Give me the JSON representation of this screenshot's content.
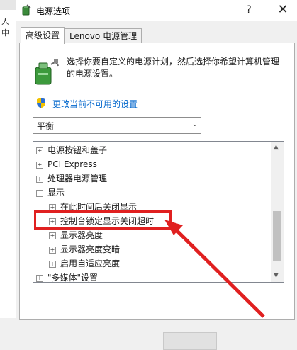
{
  "background_app": {
    "fragment": "人中"
  },
  "window": {
    "title": "电源选项",
    "help_label": "?",
    "close_label": "✕"
  },
  "tabs": [
    {
      "label": "高级设置",
      "active": true
    },
    {
      "label": "Lenovo 电源管理",
      "active": false
    }
  ],
  "description": "选择你要自定义的电源计划，然后选择你希望计算机管理的电源设置。",
  "change_link": "更改当前不可用的设置",
  "plan_select": {
    "value": "平衡"
  },
  "tree": {
    "items": [
      {
        "label": "电源按钮和盖子",
        "expander": "+"
      },
      {
        "label": "PCI Express",
        "expander": "+"
      },
      {
        "label": "处理器电源管理",
        "expander": "+"
      },
      {
        "label": "显示",
        "expander": "−"
      },
      {
        "label": "在此时间后关闭显示",
        "expander": "+"
      },
      {
        "label": "控制台锁定显示关闭超时",
        "expander": "+"
      },
      {
        "label": "显示器亮度",
        "expander": "+"
      },
      {
        "label": "显示器亮度变暗",
        "expander": "+"
      },
      {
        "label": "启用自适应亮度",
        "expander": "+"
      },
      {
        "label": "\"多媒体\"设置",
        "expander": "+"
      }
    ]
  },
  "colors": {
    "highlight": "#e02020",
    "link": "#0066cc",
    "accent_arrow": "#e02020"
  }
}
